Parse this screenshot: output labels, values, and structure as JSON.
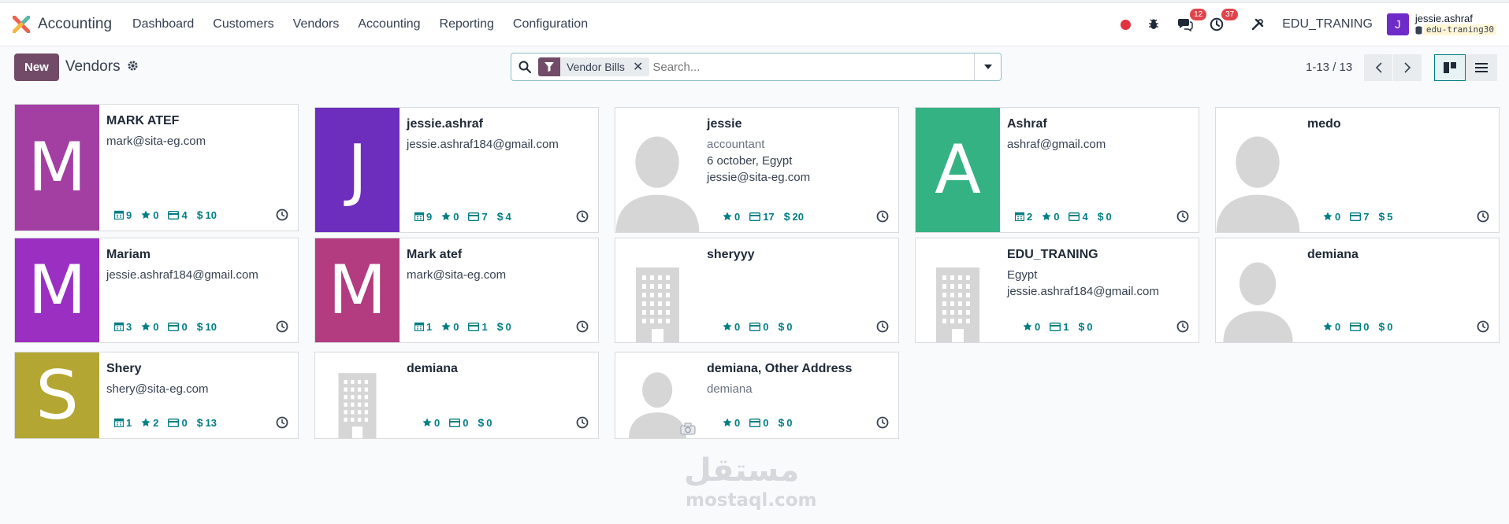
{
  "app": {
    "brand": "Accounting"
  },
  "menu": [
    "Dashboard",
    "Customers",
    "Vendors",
    "Accounting",
    "Reporting",
    "Configuration"
  ],
  "systray": {
    "messages_count": "12",
    "activities_count": "37",
    "company": "EDU_TRANING",
    "user_initial": "J",
    "user_name": "jessie.ashraf",
    "database": "edu-traning30"
  },
  "control": {
    "new_label": "New",
    "title": "Vendors",
    "facet_label": "Vendor Bills",
    "search_placeholder": "Search...",
    "pager": "1-13 / 13"
  },
  "colors": {
    "brand": "#714b67",
    "accent": "#017e84"
  },
  "cards": [
    {
      "name": "MARK ATEF",
      "lines": [
        "mark@sita-eg.com"
      ],
      "avatar": {
        "type": "letter",
        "letter": "M",
        "color": "#a33fa3"
      },
      "stats": [
        {
          "icon": "calendar-icon",
          "value": "9"
        },
        {
          "icon": "star-icon",
          "value": "0"
        },
        {
          "icon": "card-icon",
          "value": "4"
        },
        {
          "icon": "dollar-icon",
          "value": "10"
        }
      ]
    },
    {
      "name": "jessie.ashraf",
      "lines": [
        "jessie.ashraf184@gmail.com"
      ],
      "avatar": {
        "type": "letter",
        "letter": "J",
        "color": "#6d2dbd"
      },
      "stats": [
        {
          "icon": "calendar-icon",
          "value": "9"
        },
        {
          "icon": "star-icon",
          "value": "0"
        },
        {
          "icon": "card-icon",
          "value": "7"
        },
        {
          "icon": "dollar-icon",
          "value": "4"
        }
      ]
    },
    {
      "name": "jessie",
      "lines": [
        "accountant",
        "6 october, Egypt",
        "jessie@sita-eg.com"
      ],
      "muted_first": true,
      "avatar": {
        "type": "person"
      },
      "stats": [
        {
          "icon": "star-icon",
          "value": "0"
        },
        {
          "icon": "card-icon",
          "value": "17"
        },
        {
          "icon": "dollar-icon",
          "value": "20"
        }
      ]
    },
    {
      "name": "Ashraf",
      "lines": [
        "ashraf@gmail.com"
      ],
      "avatar": {
        "type": "letter",
        "letter": "A",
        "color": "#35b283"
      },
      "stats": [
        {
          "icon": "calendar-icon",
          "value": "2"
        },
        {
          "icon": "star-icon",
          "value": "0"
        },
        {
          "icon": "card-icon",
          "value": "4"
        },
        {
          "icon": "dollar-icon",
          "value": "0"
        }
      ]
    },
    {
      "name": "medo",
      "lines": [],
      "avatar": {
        "type": "person"
      },
      "stats": [
        {
          "icon": "star-icon",
          "value": "0"
        },
        {
          "icon": "card-icon",
          "value": "7"
        },
        {
          "icon": "dollar-icon",
          "value": "5"
        }
      ]
    },
    {
      "name": "Mariam",
      "lines": [
        "jessie.ashraf184@gmail.com"
      ],
      "avatar": {
        "type": "letter",
        "letter": "M",
        "color": "#9b2fc2"
      },
      "stats": [
        {
          "icon": "calendar-icon",
          "value": "3"
        },
        {
          "icon": "star-icon",
          "value": "0"
        },
        {
          "icon": "card-icon",
          "value": "0"
        },
        {
          "icon": "dollar-icon",
          "value": "10"
        }
      ]
    },
    {
      "name": "Mark atef",
      "lines": [
        "mark@sita-eg.com"
      ],
      "avatar": {
        "type": "letter",
        "letter": "M",
        "color": "#b33b7f"
      },
      "stats": [
        {
          "icon": "calendar-icon",
          "value": "1"
        },
        {
          "icon": "star-icon",
          "value": "0"
        },
        {
          "icon": "card-icon",
          "value": "1"
        },
        {
          "icon": "dollar-icon",
          "value": "0"
        }
      ]
    },
    {
      "name": "sheryyy",
      "lines": [],
      "avatar": {
        "type": "building"
      },
      "stats": [
        {
          "icon": "star-icon",
          "value": "0"
        },
        {
          "icon": "card-icon",
          "value": "0"
        },
        {
          "icon": "dollar-icon",
          "value": "0"
        }
      ]
    },
    {
      "name": "EDU_TRANING",
      "lines": [
        "Egypt",
        "jessie.ashraf184@gmail.com"
      ],
      "avatar": {
        "type": "building"
      },
      "stats": [
        {
          "icon": "star-icon",
          "value": "0"
        },
        {
          "icon": "card-icon",
          "value": "1"
        },
        {
          "icon": "dollar-icon",
          "value": "0"
        }
      ]
    },
    {
      "name": "demiana",
      "lines": [],
      "avatar": {
        "type": "person"
      },
      "stats": [
        {
          "icon": "star-icon",
          "value": "0"
        },
        {
          "icon": "card-icon",
          "value": "0"
        },
        {
          "icon": "dollar-icon",
          "value": "0"
        }
      ]
    },
    {
      "name": "Shery",
      "lines": [
        "shery@sita-eg.com"
      ],
      "avatar": {
        "type": "letter",
        "letter": "S",
        "color": "#b4a632"
      },
      "stats": [
        {
          "icon": "calendar-icon",
          "value": "1"
        },
        {
          "icon": "star-icon",
          "value": "2"
        },
        {
          "icon": "card-icon",
          "value": "0"
        },
        {
          "icon": "dollar-icon",
          "value": "13"
        }
      ]
    },
    {
      "name": "demiana",
      "lines": [],
      "avatar": {
        "type": "building"
      },
      "stats": [
        {
          "icon": "star-icon",
          "value": "0"
        },
        {
          "icon": "card-icon",
          "value": "0"
        },
        {
          "icon": "dollar-icon",
          "value": "0"
        }
      ]
    },
    {
      "name": "demiana, Other Address",
      "lines": [
        "demiana"
      ],
      "muted_first": true,
      "avatar": {
        "type": "person-camera"
      },
      "stats": [
        {
          "icon": "star-icon",
          "value": "0"
        },
        {
          "icon": "card-icon",
          "value": "0"
        },
        {
          "icon": "dollar-icon",
          "value": "0"
        }
      ]
    }
  ],
  "watermark": {
    "arabic": "مستقل",
    "latin": "mostaql.com"
  }
}
